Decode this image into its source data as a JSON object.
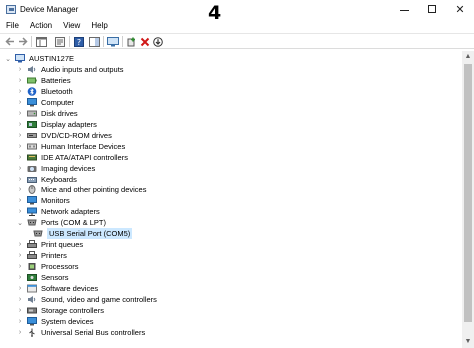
{
  "window": {
    "title": "Device Manager",
    "overlay_number": "4"
  },
  "window_controls": {
    "minimize": "minimize",
    "maximize": "maximize",
    "close": "✕"
  },
  "menu": [
    "File",
    "Action",
    "View",
    "Help"
  ],
  "toolbar": {
    "icons": [
      "back-arrow-icon",
      "forward-arrow-icon",
      "show-hide-console-tree-icon",
      "properties-icon",
      "help-icon",
      "action-pane-icon",
      "scan-hardware-icon",
      "add-driver-icon",
      "uninstall-device-icon",
      "update-driver-icon"
    ]
  },
  "tree": {
    "root": {
      "label": "AUSTIN127E",
      "icon": "computer-icon"
    },
    "items": [
      {
        "label": "Audio inputs and outputs",
        "icon": "speaker-icon",
        "expanded": false
      },
      {
        "label": "Batteries",
        "icon": "battery-icon",
        "expanded": false
      },
      {
        "label": "Bluetooth",
        "icon": "bluetooth-icon",
        "expanded": false
      },
      {
        "label": "Computer",
        "icon": "monitor-icon",
        "expanded": false
      },
      {
        "label": "Disk drives",
        "icon": "disk-drive-icon",
        "expanded": false
      },
      {
        "label": "Display adapters",
        "icon": "display-adapter-icon",
        "expanded": false
      },
      {
        "label": "DVD/CD-ROM drives",
        "icon": "dvd-drive-icon",
        "expanded": false
      },
      {
        "label": "Human Interface Devices",
        "icon": "hid-icon",
        "expanded": false
      },
      {
        "label": "IDE ATA/ATAPI controllers",
        "icon": "ide-controller-icon",
        "expanded": false
      },
      {
        "label": "Imaging devices",
        "icon": "camera-icon",
        "expanded": false
      },
      {
        "label": "Keyboards",
        "icon": "keyboard-icon",
        "expanded": false
      },
      {
        "label": "Mice and other pointing devices",
        "icon": "mouse-icon",
        "expanded": false
      },
      {
        "label": "Monitors",
        "icon": "monitor-icon",
        "expanded": false
      },
      {
        "label": "Network adapters",
        "icon": "network-adapter-icon",
        "expanded": false
      },
      {
        "label": "Ports (COM & LPT)",
        "icon": "port-icon",
        "expanded": true
      },
      {
        "label": "USB Serial Port (COM5)",
        "icon": "serial-port-icon",
        "child": true,
        "selected": true
      },
      {
        "label": "Print queues",
        "icon": "printer-icon",
        "expanded": false
      },
      {
        "label": "Printers",
        "icon": "printer-icon",
        "expanded": false
      },
      {
        "label": "Processors",
        "icon": "processor-icon",
        "expanded": false
      },
      {
        "label": "Sensors",
        "icon": "sensor-icon",
        "expanded": false
      },
      {
        "label": "Software devices",
        "icon": "software-device-icon",
        "expanded": false
      },
      {
        "label": "Sound, video and game controllers",
        "icon": "speaker-icon",
        "expanded": false
      },
      {
        "label": "Storage controllers",
        "icon": "storage-controller-icon",
        "expanded": false
      },
      {
        "label": "System devices",
        "icon": "system-device-icon",
        "expanded": false
      },
      {
        "label": "Universal Serial Bus controllers",
        "icon": "usb-icon",
        "expanded": false
      }
    ]
  },
  "colors": {
    "selection": "#cce8ff",
    "bluetooth": "#1e62c8",
    "uninstall_red": "#d01818",
    "add_green": "#2f8a2f"
  }
}
